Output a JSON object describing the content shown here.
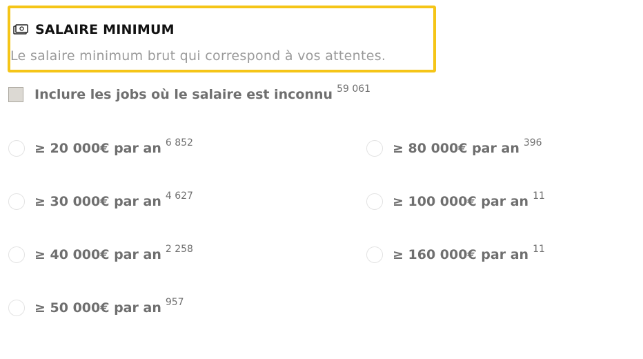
{
  "section": {
    "title": "SALAIRE MINIMUM",
    "subtitle": "Le salaire minimum brut qui correspond à vos attentes.",
    "icon": "money-bill-icon",
    "highlight_color": "#f5c518"
  },
  "unknown_salary": {
    "label": "Inclure les jobs où le salaire est inconnu",
    "count": "59 061",
    "checked": false
  },
  "options": [
    {
      "label": "≥ 20 000€ par an",
      "count": "6 852"
    },
    {
      "label": "≥ 30 000€ par an",
      "count": "4 627"
    },
    {
      "label": "≥ 40 000€ par an",
      "count": "2 258"
    },
    {
      "label": "≥ 50 000€ par an",
      "count": "957"
    },
    {
      "label": "≥ 80 000€ par an",
      "count": "396"
    },
    {
      "label": "≥ 100 000€ par an",
      "count": "11"
    },
    {
      "label": "≥ 160 000€ par an",
      "count": "11"
    }
  ]
}
